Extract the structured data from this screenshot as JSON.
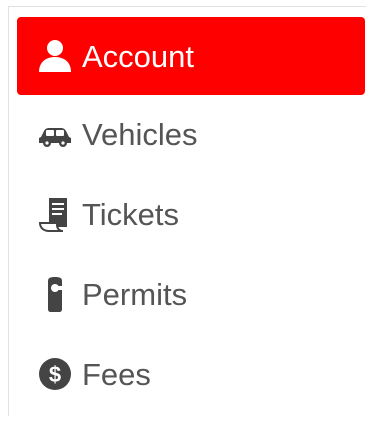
{
  "nav": {
    "items": [
      {
        "label": "Account",
        "icon": "user-icon",
        "active": true
      },
      {
        "label": "Vehicles",
        "icon": "car-icon",
        "active": false
      },
      {
        "label": "Tickets",
        "icon": "ticket-receipt-icon",
        "active": false
      },
      {
        "label": "Permits",
        "icon": "door-hanger-icon",
        "active": false
      },
      {
        "label": "Fees",
        "icon": "dollar-circle-icon",
        "active": false
      }
    ]
  },
  "colors": {
    "active_bg": "#ff0000",
    "active_text": "#ffffff",
    "inactive_text": "#555555",
    "icon": "#444444"
  }
}
